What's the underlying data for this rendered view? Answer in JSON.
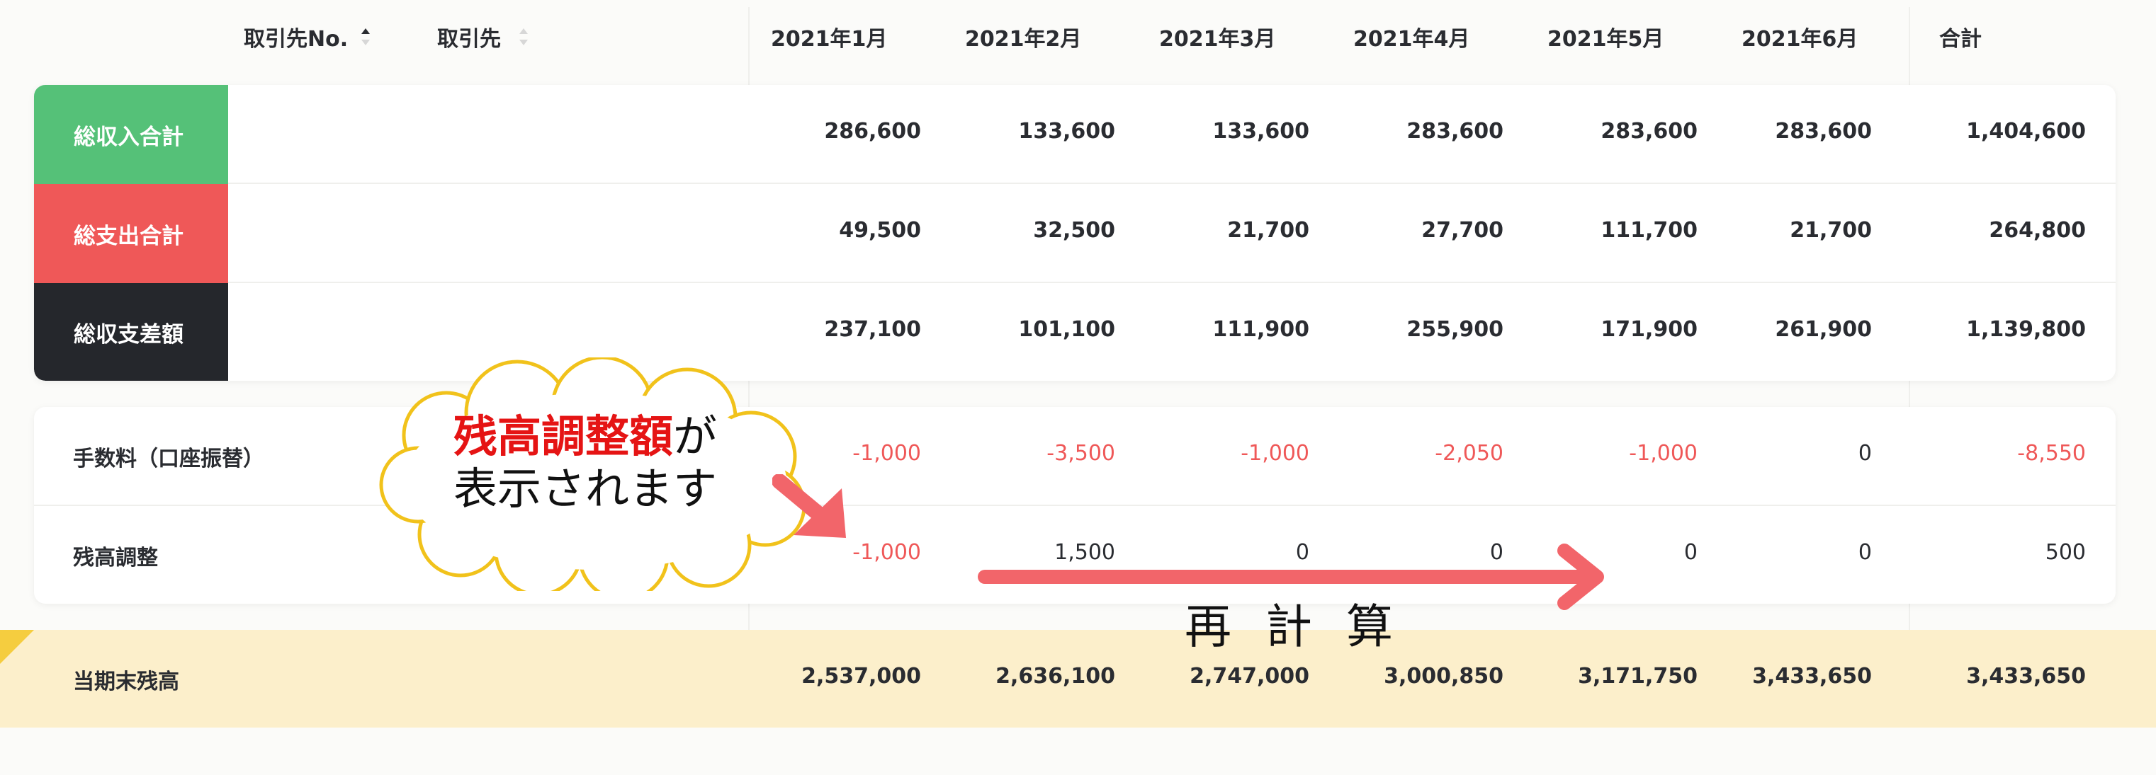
{
  "header": {
    "col_partner_no": "取引先No.",
    "col_partner": "取引先",
    "months": [
      "2021年1月",
      "2021年2月",
      "2021年3月",
      "2021年4月",
      "2021年5月",
      "2021年6月"
    ],
    "total": "合計"
  },
  "summary": {
    "income": {
      "label": "総収入合計",
      "color": "#55c178",
      "values": [
        "286,600",
        "133,600",
        "133,600",
        "283,600",
        "283,600",
        "283,600"
      ],
      "total": "1,404,600"
    },
    "expense": {
      "label": "総支出合計",
      "color": "#ef5858",
      "values": [
        "49,500",
        "32,500",
        "21,700",
        "27,700",
        "111,700",
        "21,700"
      ],
      "total": "264,800"
    },
    "diff": {
      "label": "総収支差額",
      "color": "#25272c",
      "values": [
        "237,100",
        "101,100",
        "111,900",
        "255,900",
        "171,900",
        "261,900"
      ],
      "total": "1,139,800"
    }
  },
  "details": {
    "fee": {
      "label": "手数料（口座振替）",
      "values": [
        "-1,000",
        "-3,500",
        "-1,000",
        "-2,050",
        "-1,000",
        "0"
      ],
      "total": "-8,550"
    },
    "adjust": {
      "label": "残高調整",
      "values": [
        "-1,000",
        "1,500",
        "0",
        "0",
        "0",
        "0"
      ],
      "total": "500"
    }
  },
  "closing": {
    "label": "当期末残高",
    "values": [
      "2,537,000",
      "2,636,100",
      "2,747,000",
      "3,000,850",
      "3,171,750",
      "3,433,650"
    ],
    "total": "3,433,650"
  },
  "annotation": {
    "highlight": "残高調整額",
    "particle": "が",
    "line2": "表示されます",
    "recalc": "再計算"
  },
  "colors": {
    "negative": "#ef5858",
    "annotation_red": "#e51414",
    "arrow": "#f2656a",
    "cloud_border": "#f1c21b"
  }
}
